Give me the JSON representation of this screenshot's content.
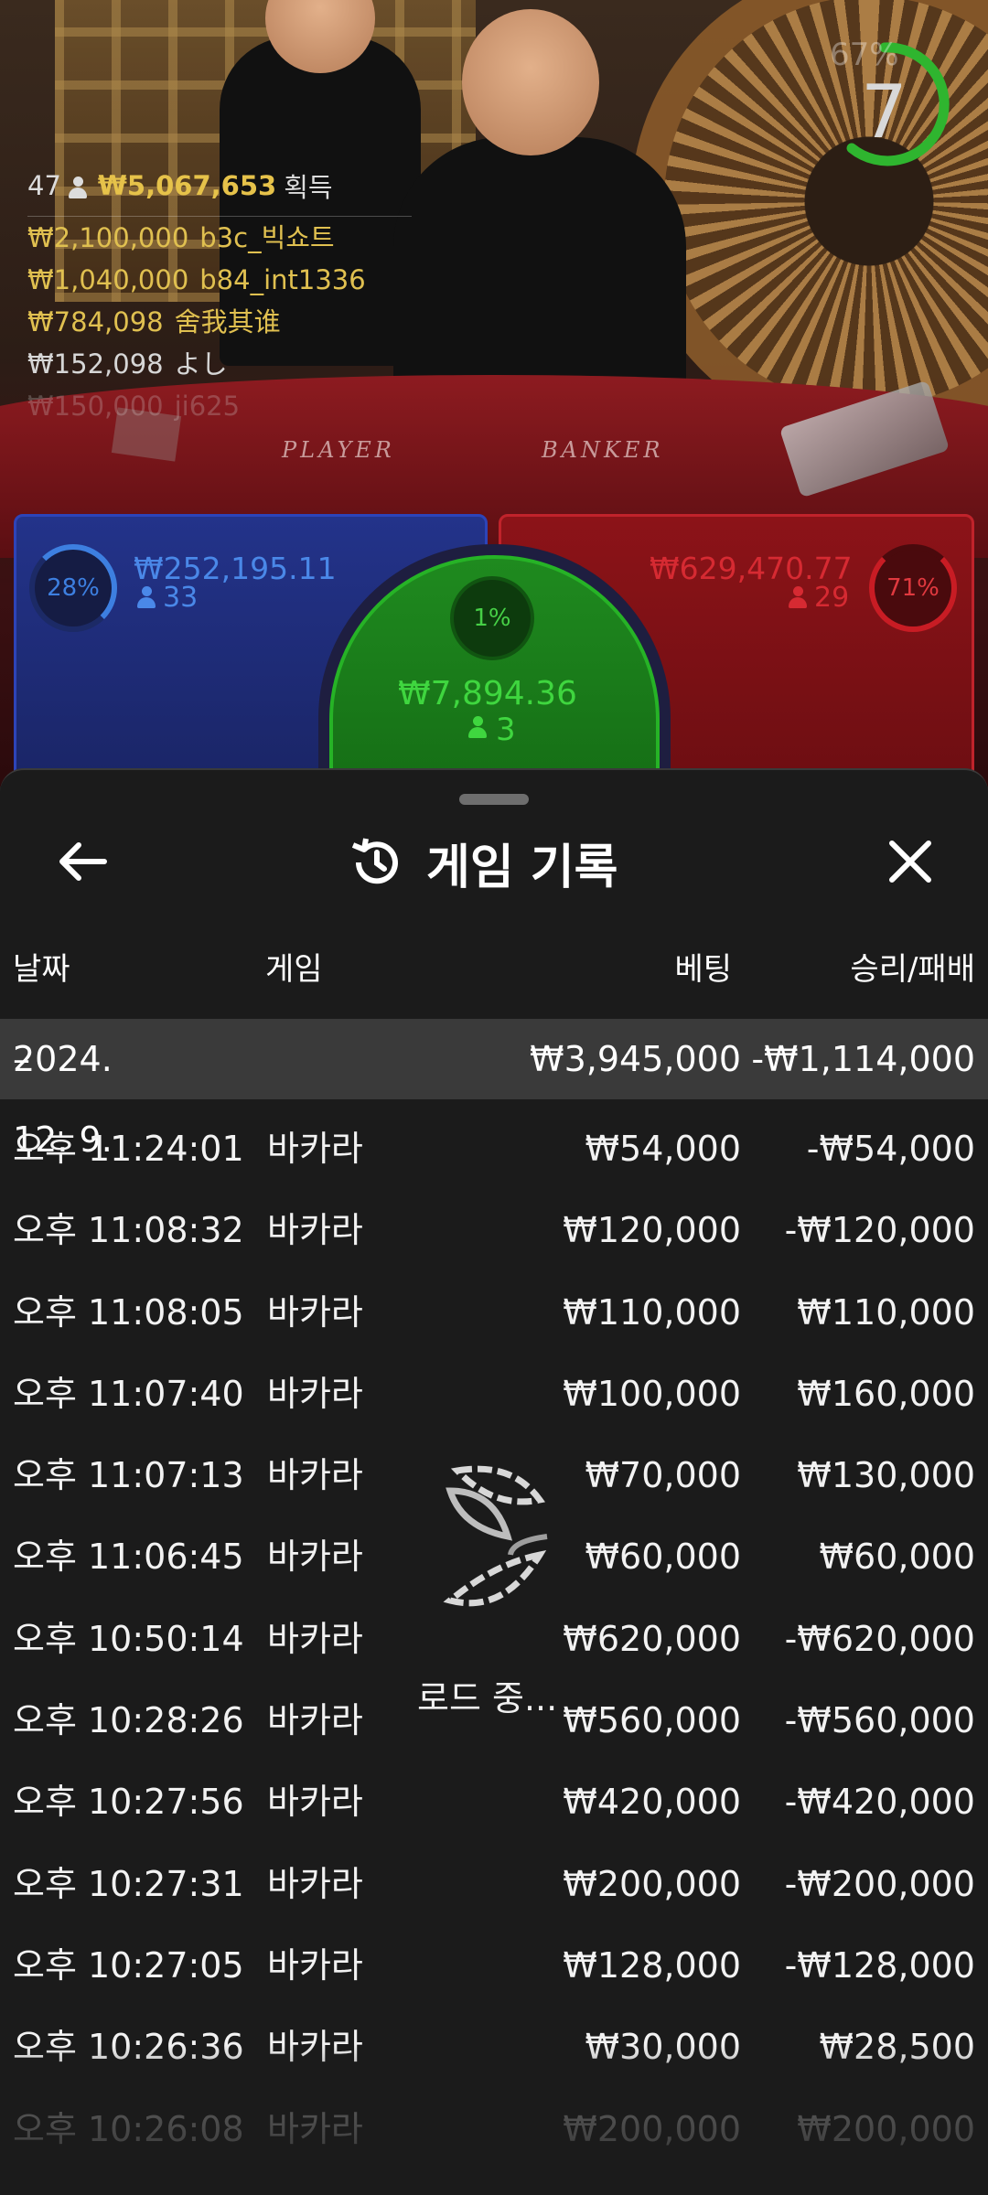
{
  "winners": {
    "count": "47",
    "total": "₩5,067,653",
    "total_suffix": "획득",
    "rows": [
      {
        "amount": "₩2,100,000",
        "user": "b3c_빅쇼트"
      },
      {
        "amount": "₩1,040,000",
        "user": "b84_int1336"
      },
      {
        "amount": "₩784,098",
        "user": "舍我其谁"
      },
      {
        "amount": "₩152,098",
        "user": "よし"
      },
      {
        "amount": "₩150,000",
        "user": "ji625"
      }
    ]
  },
  "timer": {
    "percent": "67%",
    "seconds": "7"
  },
  "table_labels": {
    "player": "PLAYER",
    "banker": "BANKER"
  },
  "bets": {
    "player": {
      "percent": "28%",
      "amount": "₩252,195.11",
      "players": "33"
    },
    "banker": {
      "percent": "71%",
      "amount": "₩629,470.77",
      "players": "29"
    },
    "tie": {
      "percent": "1%",
      "amount": "₩7,894.36",
      "players": "3"
    }
  },
  "history": {
    "title": "게임 기록",
    "columns": {
      "date": "날짜",
      "game": "게임",
      "bet": "베팅",
      "result": "승리/패배"
    },
    "group": {
      "toggle": "–",
      "date": "2024. 12. 9.",
      "bet": "₩3,945,000",
      "result": "-₩1,114,000"
    },
    "rows": [
      {
        "time": "오후 11:24:01",
        "game": "바카라",
        "bet": "₩54,000",
        "result": "-₩54,000"
      },
      {
        "time": "오후 11:08:32",
        "game": "바카라",
        "bet": "₩120,000",
        "result": "-₩120,000"
      },
      {
        "time": "오후 11:08:05",
        "game": "바카라",
        "bet": "₩110,000",
        "result": "₩110,000"
      },
      {
        "time": "오후 11:07:40",
        "game": "바카라",
        "bet": "₩100,000",
        "result": "₩160,000"
      },
      {
        "time": "오후 11:07:13",
        "game": "바카라",
        "bet": "₩70,000",
        "result": "₩130,000"
      },
      {
        "time": "오후 11:06:45",
        "game": "바카라",
        "bet": "₩60,000",
        "result": "₩60,000"
      },
      {
        "time": "오후 10:50:14",
        "game": "바카라",
        "bet": "₩620,000",
        "result": "-₩620,000"
      },
      {
        "time": "오후 10:28:26",
        "game": "바카라",
        "bet": "₩560,000",
        "result": "-₩560,000"
      },
      {
        "time": "오후 10:27:56",
        "game": "바카라",
        "bet": "₩420,000",
        "result": "-₩420,000"
      },
      {
        "time": "오후 10:27:31",
        "game": "바카라",
        "bet": "₩200,000",
        "result": "-₩200,000"
      },
      {
        "time": "오후 10:27:05",
        "game": "바카라",
        "bet": "₩128,000",
        "result": "-₩128,000"
      },
      {
        "time": "오후 10:26:36",
        "game": "바카라",
        "bet": "₩30,000",
        "result": "₩28,500"
      },
      {
        "time": "오후 10:26:08",
        "game": "바카라",
        "bet": "₩200,000",
        "result": "₩200,000"
      }
    ],
    "loading_text": "로드 중..."
  },
  "icons": {
    "back": "arrow-left-icon",
    "history": "history-icon",
    "close": "close-icon",
    "loader": "spinner-icon"
  },
  "colors": {
    "player": "#3d7fe0",
    "banker": "#d62a32",
    "tie": "#3fd63f",
    "winner_gold": "#e0c050",
    "timer": "#2fb52f"
  }
}
